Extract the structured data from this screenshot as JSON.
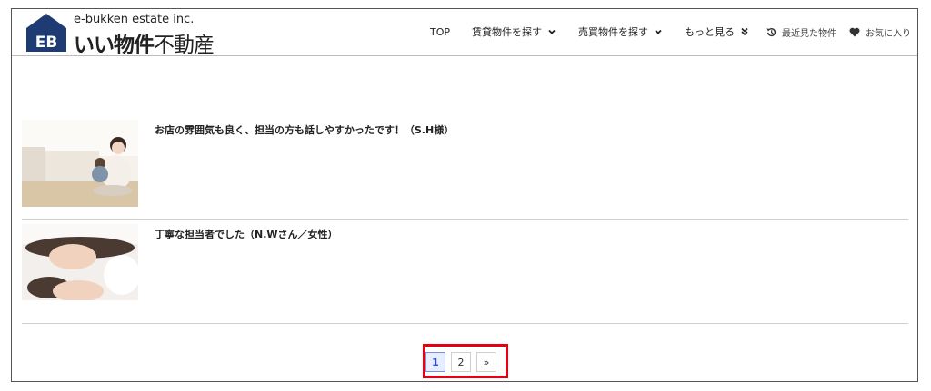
{
  "brand": {
    "name_en": "e-bukken estate inc.",
    "name_jp_bold": "いい物件",
    "name_jp_light": "不動産",
    "logo_mark": "EB",
    "color": "#1f3b73"
  },
  "nav": {
    "items": [
      {
        "label": "TOP"
      },
      {
        "label": "賃貸物件を探す"
      },
      {
        "label": "売買物件を探す"
      },
      {
        "label": "もっと見る"
      }
    ],
    "recent_label": "最近見た物件",
    "favorites_label": "お気に入り"
  },
  "reviews": [
    {
      "title": "お店の雰囲気も良く、担当の方も話しやすかったです！（S.H様）",
      "image": "mother-and-child-on-sofa"
    },
    {
      "title": "丁寧な担当者でした（N.Wさん／女性）",
      "image": "family-lying-on-bed"
    }
  ],
  "pagination": {
    "pages": [
      "1",
      "2"
    ],
    "current": "1",
    "next_label": "»",
    "highlight_color": "#e60012"
  }
}
